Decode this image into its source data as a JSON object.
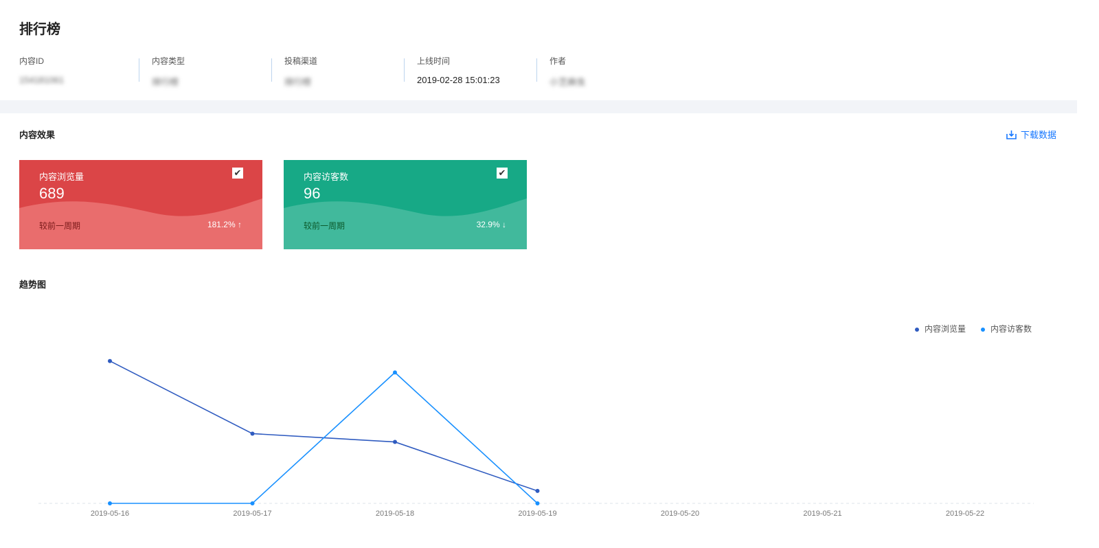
{
  "title": "排行榜",
  "meta": [
    {
      "label": "内容ID",
      "value": "154181061",
      "blurred": true
    },
    {
      "label": "内容类型",
      "value": "排行榜",
      "blurred": true
    },
    {
      "label": "投稿渠道",
      "value": "排行榜",
      "blurred": true
    },
    {
      "label": "上线时间",
      "value": "2019-02-28 15:01:23",
      "blurred": false
    },
    {
      "label": "作者",
      "value": "小芝麻虫",
      "blurred": true
    }
  ],
  "effect_title": "内容效果",
  "download_label": "下载数据",
  "cards": [
    {
      "name": "内容浏览量",
      "value": "689",
      "compare_label": "较前一周期",
      "pct": "181.2%",
      "trend": "↑",
      "checked": true,
      "color": "#db4547",
      "wave": "#e96d6d",
      "compare_color": "#7a1a1a"
    },
    {
      "name": "内容访客数",
      "value": "96",
      "compare_label": "较前一周期",
      "pct": "32.9%",
      "trend": "↓",
      "checked": true,
      "color": "#17a986",
      "wave": "#41b99c",
      "compare_color": "#0c5a2c"
    }
  ],
  "trend_title": "趋势图",
  "chart_data": {
    "type": "line",
    "x": [
      "2019-05-16",
      "2019-05-17",
      "2019-05-18",
      "2019-05-19",
      "2019-05-20",
      "2019-05-21",
      "2019-05-22"
    ],
    "series": [
      {
        "name": "内容浏览量",
        "values": [
          343,
          168,
          148,
          30
        ],
        "color": "#2f5bc0",
        "ylim": [
          0,
          460
        ]
      },
      {
        "name": "内容访客数",
        "values": [
          0,
          0,
          96,
          0
        ],
        "color": "#1890ff",
        "ylim": [
          0,
          140
        ]
      }
    ],
    "legend": "top-right",
    "grid": false
  }
}
